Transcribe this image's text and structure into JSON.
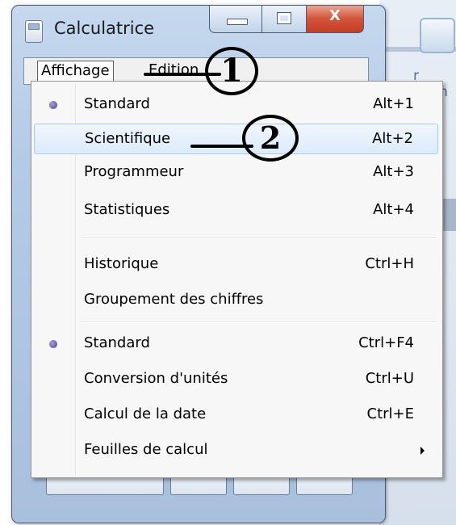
{
  "window": {
    "title": "Calculatrice",
    "close_glyph": "X"
  },
  "background_app": {
    "partial_label": "r Form"
  },
  "menubar": {
    "items": [
      {
        "label": "Affichage",
        "open": true
      },
      {
        "label": "Edition"
      }
    ]
  },
  "dropdown": {
    "groups": [
      [
        {
          "label": "Standard",
          "shortcut": "Alt+1",
          "radio_selected": true
        },
        {
          "label": "Scientifique",
          "shortcut": "Alt+2",
          "highlighted": true
        },
        {
          "label": "Programmeur",
          "shortcut": "Alt+3"
        },
        {
          "label": "Statistiques",
          "shortcut": "Alt+4"
        }
      ],
      [
        {
          "label": "Historique",
          "shortcut": "Ctrl+H"
        },
        {
          "label": "Groupement des chiffres",
          "shortcut": ""
        }
      ],
      [
        {
          "label": "Standard",
          "shortcut": "Ctrl+F4",
          "radio_selected": true
        },
        {
          "label": "Conversion d'unités",
          "shortcut": "Ctrl+U"
        },
        {
          "label": "Calcul de la date",
          "shortcut": "Ctrl+E"
        },
        {
          "label": "Feuilles de calcul",
          "shortcut": "",
          "submenu": true
        }
      ]
    ]
  },
  "annotations": [
    {
      "number": "1"
    },
    {
      "number": "2"
    }
  ],
  "colors": {
    "radio": "#4b3f94",
    "hover_bg": "#dcebfc",
    "hover_border": "#aacbef",
    "close_button": "#c33d23"
  }
}
